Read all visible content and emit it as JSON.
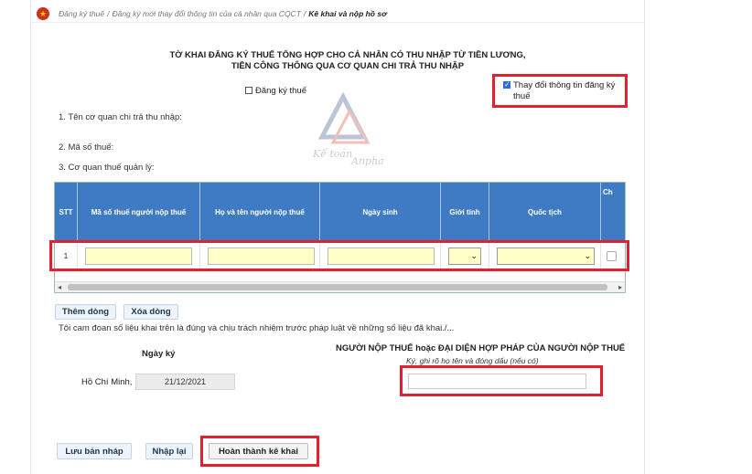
{
  "breadcrumb": {
    "item1": "Đăng ký thuế",
    "item2": "Đăng ký mới thay đổi thông tin của cá nhân qua CQCT",
    "current": "Kê khai và nộp hồ sơ",
    "separator": "/"
  },
  "form": {
    "title_line1": "TỜ KHAI ĐĂNG KÝ THUẾ TỔNG HỢP CHO CÁ NHÂN CÓ THU NHẬP TỪ TIỀN LƯƠNG,",
    "title_line2": "TIỀN CÔNG THÔNG QUA CƠ QUAN CHI TRẢ THU NHẬP",
    "checkbox_register": {
      "label": "Đăng ký thuế",
      "checked": false
    },
    "checkbox_change": {
      "label_line1": "Thay đổi thông tin đăng ký",
      "label_line2": "thuế",
      "checked": true
    },
    "field1": "1. Tên cơ quan chi trả thu nhập:",
    "field2": "2. Mã số thuế:",
    "field3": "3. Cơ quan thuế quản lý:"
  },
  "watermark": {
    "line1": "Kế toán",
    "line2": "Anpha"
  },
  "table": {
    "headers": [
      "STT",
      "Mã số thuế người nộp thuế",
      "Họ và tên người nộp thuế",
      "Ngày sinh",
      "Giới tính",
      "Quốc tịch",
      "Ch"
    ],
    "rows": [
      {
        "stt": "1"
      }
    ]
  },
  "buttons": {
    "add_row": "Thêm dòng",
    "delete_row": "Xóa dòng",
    "save_draft": "Lưu bản nháp",
    "reenter": "Nhập lại",
    "complete": "Hoàn thành kê khai"
  },
  "declaration": "Tôi cam đoan số liệu khai trên là đúng và chịu trách nhiệm trước pháp luật về những số liệu đã khai./...",
  "sign": {
    "date_label": "Ngày ký",
    "place": "Hồ Chí Minh,",
    "date_value": "21/12/2021",
    "taxpayer_heading": "NGƯỜI NỘP THUẾ hoặc ĐẠI DIỆN HỢP PHÁP CỦA NGƯỜI NỘP THUẾ",
    "taxpayer_note": "Ký, ghi rõ họ tên và đóng dấu (nếu có)"
  },
  "colors": {
    "table_header": "#3f7bc3",
    "highlight_box": "#e0212f",
    "input_fill": "#ffffc8"
  }
}
